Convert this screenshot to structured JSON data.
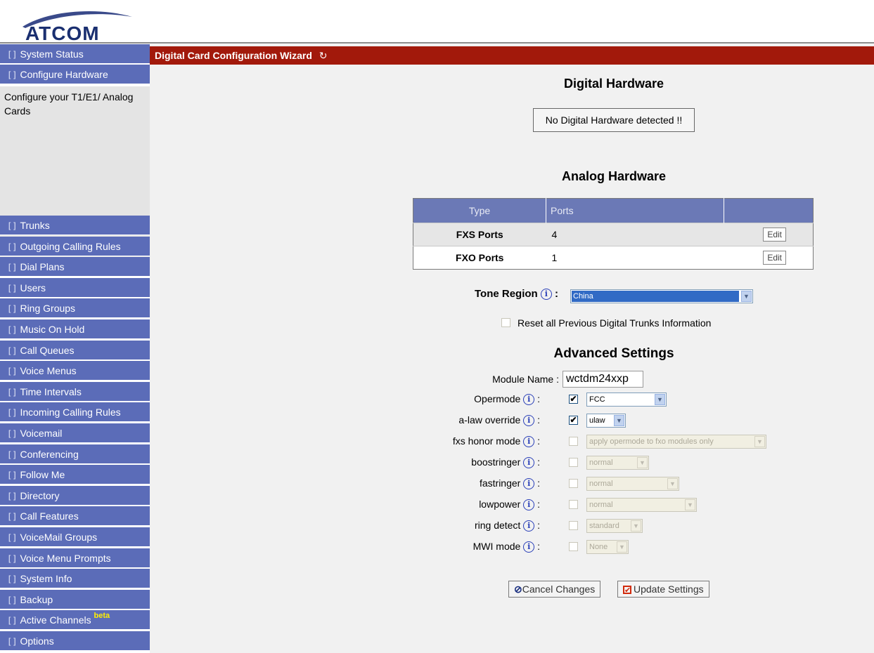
{
  "brand": {
    "logo_text": "ATCOM"
  },
  "sidebar": {
    "items": [
      {
        "label": "System Status"
      },
      {
        "label": "Configure Hardware"
      },
      {
        "label": "Trunks"
      },
      {
        "label": "Outgoing Calling Rules"
      },
      {
        "label": "Dial Plans"
      },
      {
        "label": "Users"
      },
      {
        "label": "Ring Groups"
      },
      {
        "label": "Music On Hold"
      },
      {
        "label": "Call Queues"
      },
      {
        "label": "Voice Menus"
      },
      {
        "label": "Time Intervals"
      },
      {
        "label": "Incoming Calling Rules"
      },
      {
        "label": "Voicemail"
      },
      {
        "label": "Conferencing"
      },
      {
        "label": "Follow Me"
      },
      {
        "label": "Directory"
      },
      {
        "label": "Call Features"
      },
      {
        "label": "VoiceMail Groups"
      },
      {
        "label": "Voice Menu Prompts"
      },
      {
        "label": "System Info"
      },
      {
        "label": "Backup"
      },
      {
        "label": "Active Channels",
        "badge": "beta"
      },
      {
        "label": "Options"
      }
    ],
    "description": "Configure your T1/E1/ Analog Cards",
    "bullet": "[]"
  },
  "main": {
    "title": "Digital Card Configuration Wizard",
    "refresh_icon": "refresh-icon",
    "digital": {
      "heading": "Digital Hardware",
      "message": "No Digital Hardware detected !!"
    },
    "analog": {
      "heading": "Analog Hardware",
      "columns": [
        "Type",
        "Ports",
        ""
      ],
      "rows": [
        {
          "type": "FXS Ports",
          "ports": "4",
          "action": "Edit"
        },
        {
          "type": "FXO Ports",
          "ports": "1",
          "action": "Edit"
        }
      ]
    },
    "tone_region": {
      "label": "Tone Region",
      "value": "China"
    },
    "reset": {
      "label": "Reset all Previous Digital Trunks Information",
      "checked": false
    },
    "advanced": {
      "heading": "Advanced Settings",
      "module_name": {
        "label": "Module Name :",
        "value": "wctdm24xxp"
      },
      "opermode": {
        "label": "Opermode",
        "checked": true,
        "value": "FCC"
      },
      "alaw_override": {
        "label": "a-law override",
        "checked": true,
        "value": "ulaw"
      },
      "fxs_honor_mode": {
        "label": "fxs honor mode",
        "checked": false,
        "value": "apply opermode to fxo modules only"
      },
      "boostringer": {
        "label": "boostringer",
        "checked": false,
        "value": "normal"
      },
      "fastringer": {
        "label": "fastringer",
        "checked": false,
        "value": "normal"
      },
      "lowpower": {
        "label": "lowpower",
        "checked": false,
        "value": "normal"
      },
      "ring_detect": {
        "label": "ring detect",
        "checked": false,
        "value": "standard"
      },
      "mwi_mode": {
        "label": "MWI mode",
        "checked": false,
        "value": "None"
      }
    },
    "buttons": {
      "cancel": "Cancel Changes",
      "update": "Update Settings"
    }
  },
  "colors": {
    "sidebar_bg": "#5b6cb8",
    "title_bar": "#a2190b",
    "main_bg": "#f1f1f1",
    "table_header": "#6b79b6",
    "info_icon": "#2a3fb8"
  }
}
